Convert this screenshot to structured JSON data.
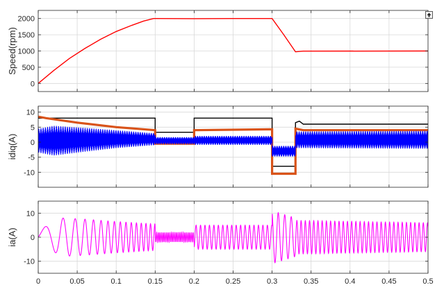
{
  "figure": {
    "toolbar": {
      "dock_icon": "dock-arrow-icon"
    }
  },
  "chart_data": [
    {
      "type": "line",
      "ylabel": "Speed(rpm)",
      "xlim": [
        0,
        0.5
      ],
      "ylim": [
        -250,
        2250
      ],
      "yticks": [
        0,
        500,
        1000,
        1500,
        2000
      ],
      "xtick_labels_shown": false,
      "grid": true,
      "series": [
        {
          "color": "#ff0000",
          "x": [
            0,
            0.02,
            0.04,
            0.06,
            0.08,
            0.1,
            0.12,
            0.135,
            0.148,
            0.15,
            0.2,
            0.25,
            0.3,
            0.315,
            0.33,
            0.34,
            0.5
          ],
          "y": [
            0,
            400,
            770,
            1080,
            1360,
            1600,
            1790,
            1920,
            2000,
            2000,
            1995,
            2000,
            2000,
            1500,
            975,
            995,
            1000
          ]
        }
      ]
    },
    {
      "type": "line",
      "ylabel": "idiq(A)",
      "xlim": [
        0,
        0.5
      ],
      "ylim": [
        -15,
        12
      ],
      "yticks": [
        -10,
        -5,
        0,
        5,
        10
      ],
      "xtick_labels_shown": false,
      "grid": true,
      "series": [
        {
          "color": "#000000",
          "x": [
            0,
            0.15,
            0.15,
            0.2,
            0.2,
            0.3,
            0.3,
            0.33,
            0.33,
            0.335,
            0.34,
            0.5
          ],
          "y": [
            8,
            8,
            3.3,
            3.3,
            8,
            8,
            -8,
            -8,
            6.5,
            7,
            6,
            6
          ]
        },
        {
          "color": "#d95319",
          "x": [
            0,
            0.01,
            0.05,
            0.1,
            0.15,
            0.15,
            0.2,
            0.2,
            0.3,
            0.3,
            0.33,
            0.33,
            0.34,
            0.5
          ],
          "y": [
            8.5,
            8,
            6.5,
            5,
            4,
            -0.5,
            -0.5,
            4,
            4.3,
            -10.5,
            -10.5,
            4.5,
            4,
            4
          ]
        },
        {
          "color": "#0000ff",
          "x": [
            0,
            0.02,
            0.06,
            0.1,
            0.15,
            0.15,
            0.2,
            0.2,
            0.3,
            0.3,
            0.33,
            0.33,
            0.5
          ],
          "y": [
            0.5,
            0.5,
            0.8,
            1.0,
            1.0,
            0.5,
            0.5,
            0.6,
            0.6,
            -3.0,
            -3.0,
            0.8,
            0.8
          ],
          "ripple_amplitude": [
            4,
            5,
            4,
            3,
            2,
            1.2,
            1.2,
            1.5,
            1.5,
            1.8,
            1.8,
            2.8,
            3
          ]
        }
      ]
    },
    {
      "type": "line",
      "ylabel": "ia(A)",
      "xlim": [
        0,
        0.5
      ],
      "xticks": [
        0,
        0.05,
        0.1,
        0.15,
        0.2,
        0.25,
        0.3,
        0.35,
        0.4,
        0.45,
        0.5
      ],
      "xtick_labels": [
        "0",
        "0.05",
        "0.1",
        "0.15",
        "0.2",
        "0.25",
        "0.3",
        "0.35",
        "0.4",
        "0.45",
        "0.5"
      ],
      "ylim": [
        -15,
        15
      ],
      "yticks": [
        -10,
        0,
        10
      ],
      "grid": true,
      "series": [
        {
          "color": "#ff00ff",
          "x": [
            0,
            0.02,
            0.03,
            0.06,
            0.1,
            0.15,
            0.15,
            0.2,
            0.2,
            0.3,
            0.3,
            0.31,
            0.33,
            0.33,
            0.5
          ],
          "amplitude": [
            3,
            6,
            8,
            7.5,
            6.5,
            5.5,
            2,
            2,
            5,
            5,
            11,
            10,
            8,
            7,
            6
          ]
        }
      ]
    }
  ]
}
